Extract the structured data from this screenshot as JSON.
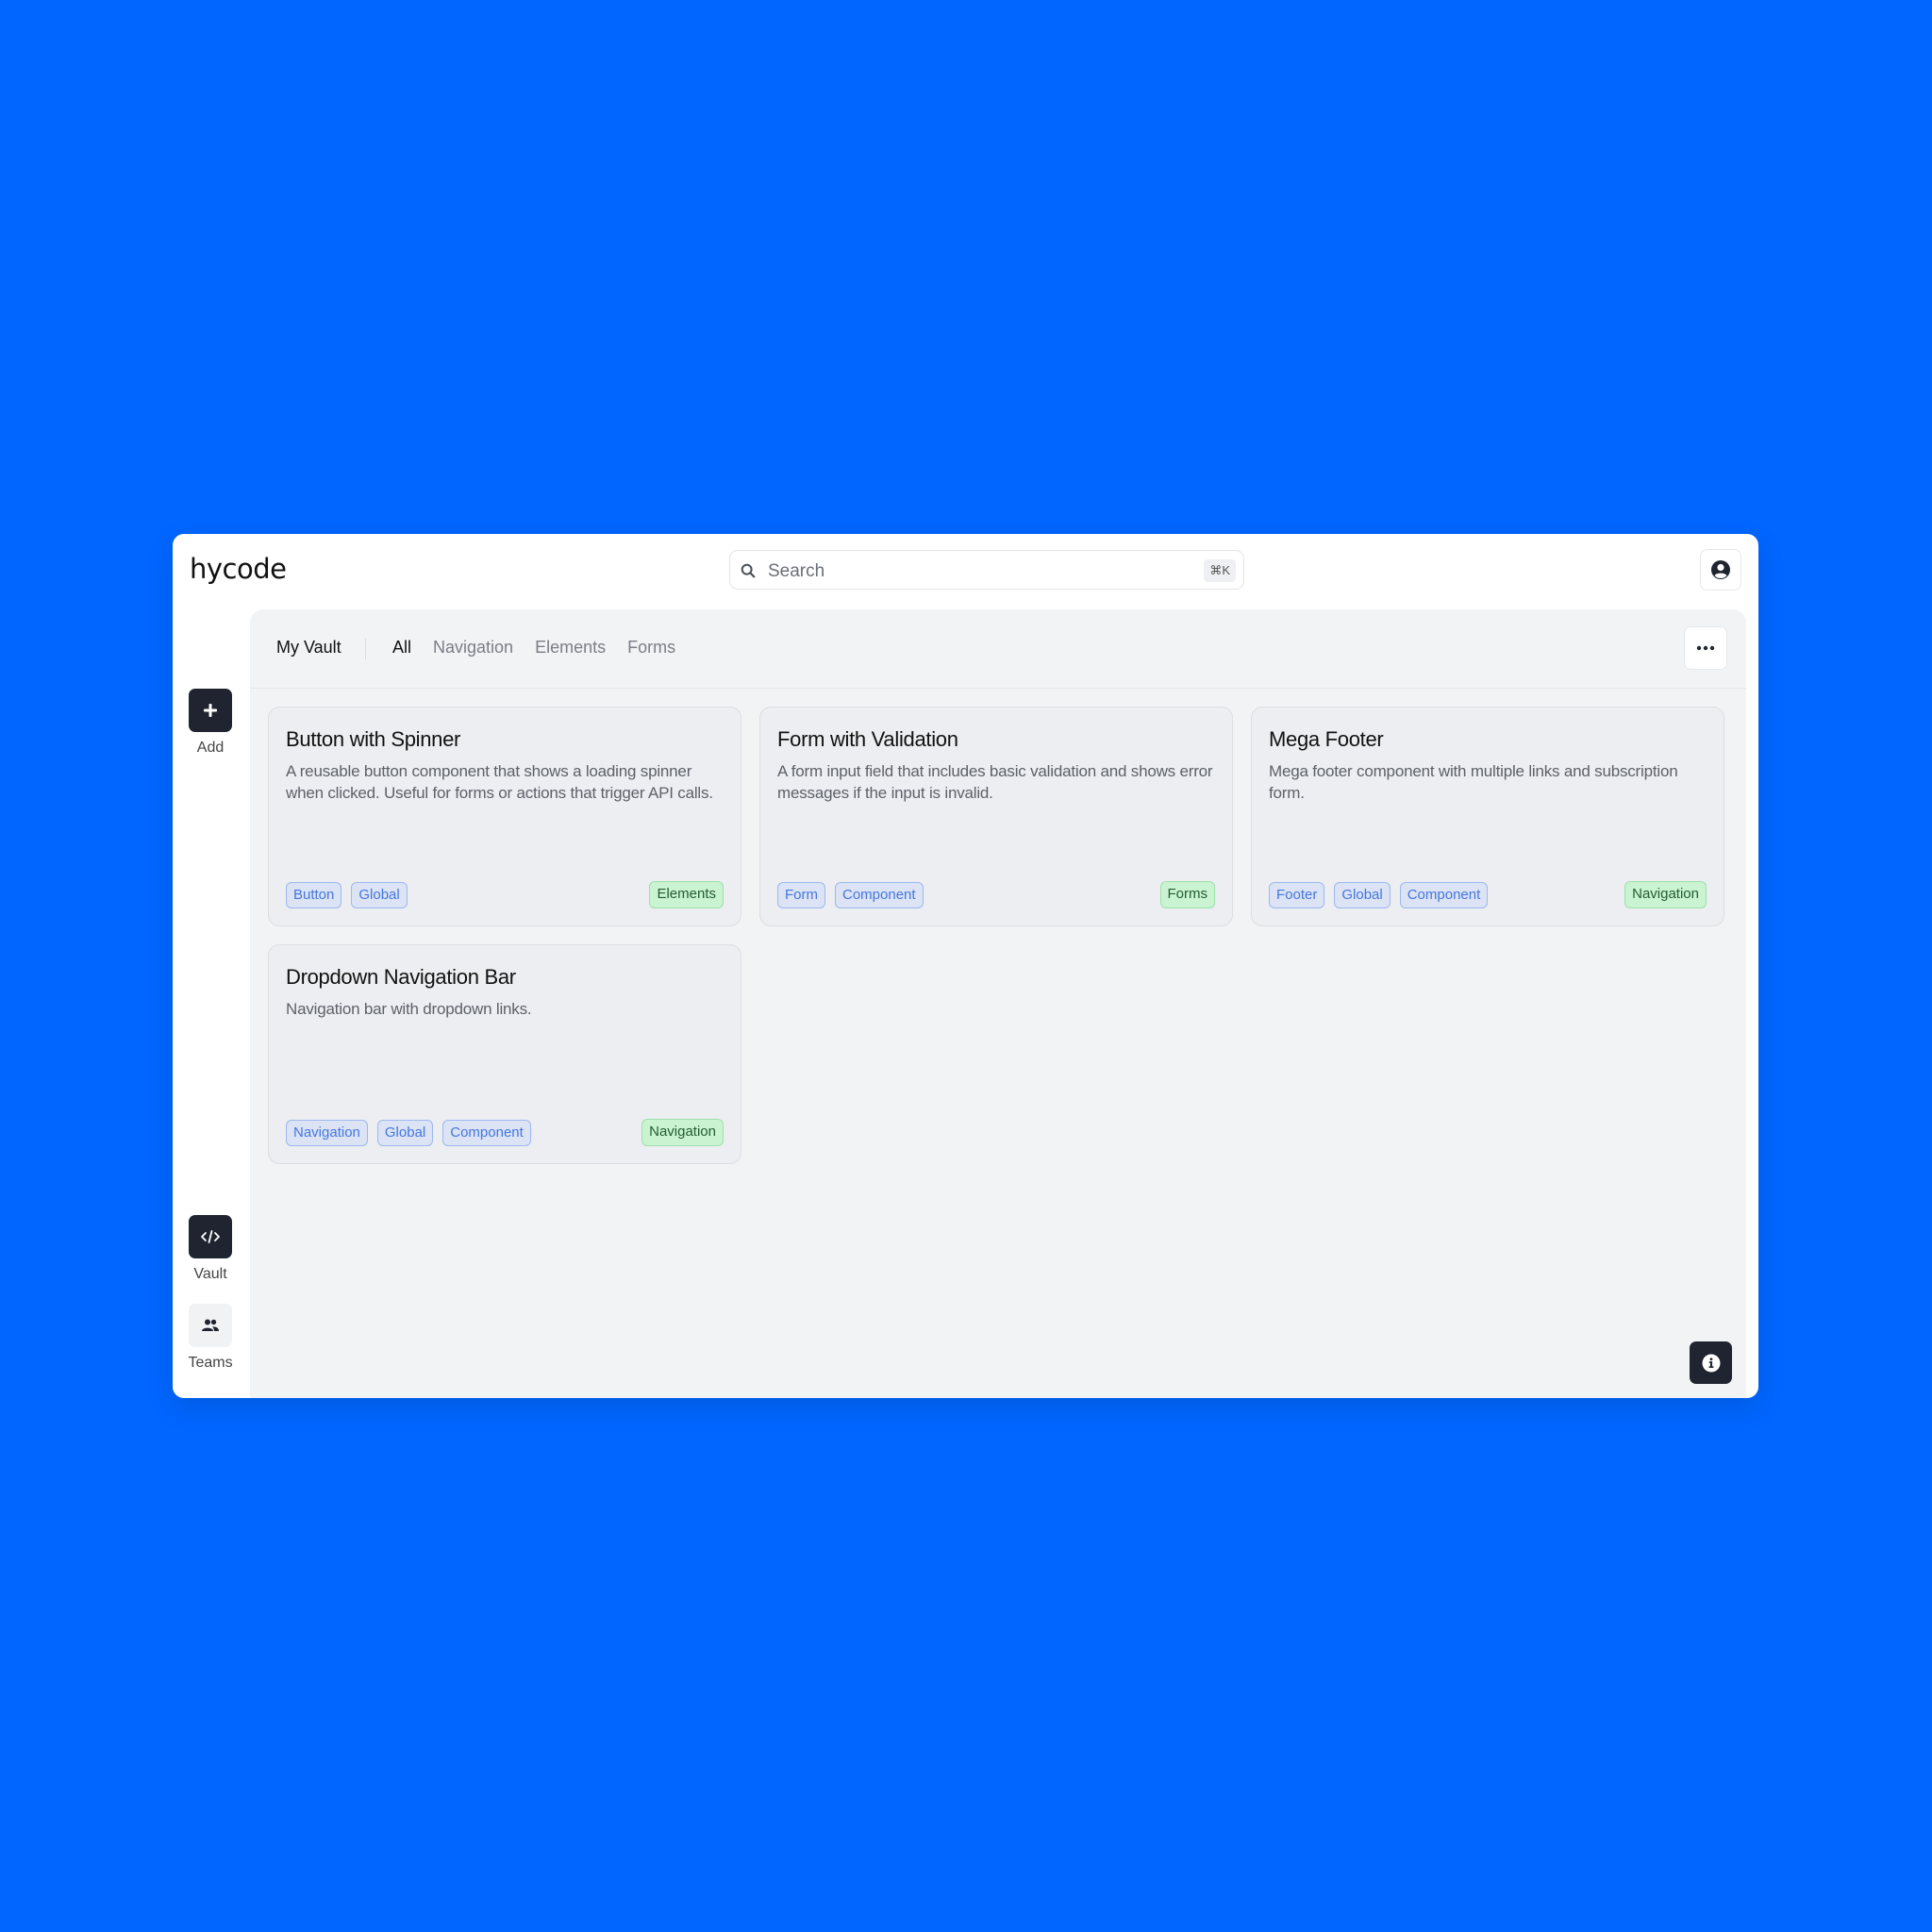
{
  "app": {
    "logo": "hycode"
  },
  "search": {
    "placeholder": "Search",
    "value": "",
    "shortcut": "⌘K"
  },
  "header": {
    "profile_icon": "user-circle-icon"
  },
  "sidebar": {
    "add": {
      "label": "Add",
      "icon": "plus-icon"
    },
    "items": [
      {
        "label": "Vault",
        "icon": "code-icon",
        "active": true
      },
      {
        "label": "Teams",
        "icon": "users-icon",
        "active": false
      }
    ]
  },
  "main": {
    "title": "My Vault",
    "tabs": [
      {
        "label": "All",
        "active": true
      },
      {
        "label": "Navigation",
        "active": false
      },
      {
        "label": "Elements",
        "active": false
      },
      {
        "label": "Forms",
        "active": false
      }
    ],
    "more_icon": "ellipsis-icon",
    "cards": [
      {
        "title": "Button with Spinner",
        "description": "A reusable button component that shows a loading spinner when clicked. Useful for forms or actions that trigger API calls.",
        "tags": [
          "Button",
          "Global"
        ],
        "category": "Elements"
      },
      {
        "title": "Form with Validation",
        "description": "A form input field that includes basic validation and shows error messages if the input is invalid.",
        "tags": [
          "Form",
          "Component"
        ],
        "category": "Forms"
      },
      {
        "title": "Mega Footer",
        "description": "Mega footer component with multiple links and subscription form.",
        "tags": [
          "Footer",
          "Global",
          "Component"
        ],
        "category": "Navigation"
      },
      {
        "title": "Dropdown Navigation Bar",
        "description": "Navigation bar with dropdown links.",
        "tags": [
          "Navigation",
          "Global",
          "Component"
        ],
        "category": "Navigation"
      }
    ],
    "info_icon": "info-icon"
  },
  "colors": {
    "background": "#0066ff",
    "dark_button": "#1f2430",
    "tag_blue": "#4577de",
    "category_green": "#245c32"
  }
}
